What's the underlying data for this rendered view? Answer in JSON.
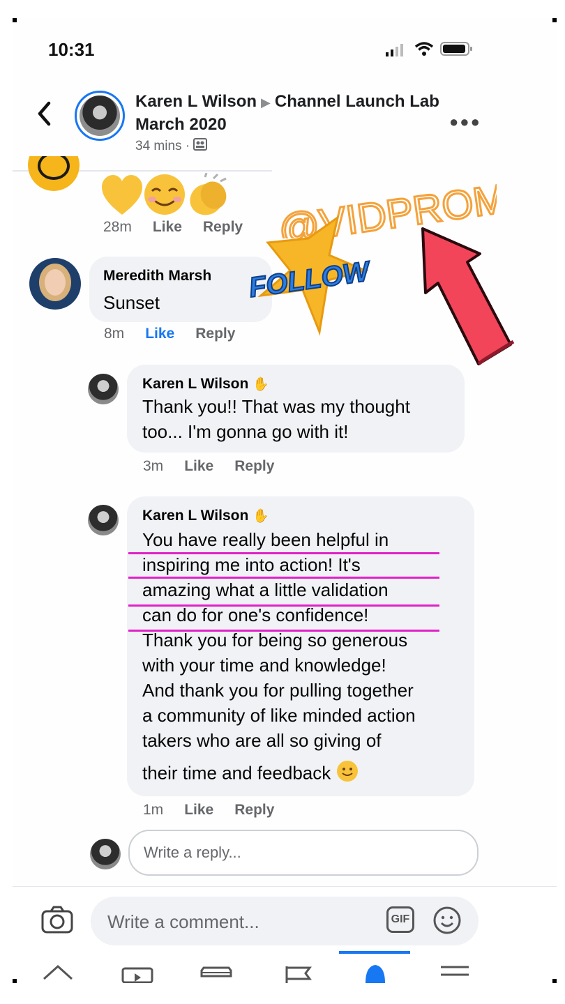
{
  "status_bar": {
    "time": "10:31"
  },
  "header": {
    "author": "Karen L Wilson",
    "group": "Channel Launch Lab March 2020",
    "time_ago": "34 mins",
    "separator": "·"
  },
  "prev_comment": {
    "time": "28m",
    "like": "Like",
    "reply": "Reply"
  },
  "comments": [
    {
      "name": "Meredith Marsh",
      "text": "Sunset",
      "time": "8m",
      "like": "Like",
      "reply": "Reply"
    },
    {
      "name": "Karen L Wilson",
      "text_lines": [
        "Thank you!! That was my thought",
        "too... I'm gonna go with it!"
      ],
      "time": "3m",
      "like": "Like",
      "reply": "Reply"
    },
    {
      "name": "Karen L Wilson",
      "text_lines": [
        "You have really been helpful in",
        "inspiring me into action! It's",
        "amazing what a little validation",
        "can do for one's confidence!",
        "Thank you for being so generous",
        "with your time and knowledge!",
        "And thank you for pulling together",
        "a community of like minded action",
        "takers who are all so giving of",
        "their time and feedback"
      ],
      "time": "1m",
      "like": "Like",
      "reply": "Reply"
    }
  ],
  "reply_box": {
    "placeholder": "Write a reply..."
  },
  "comment_box": {
    "placeholder": "Write a comment...",
    "gif_label": "GIF"
  },
  "overlay": {
    "handle": "@VIDPROMOM",
    "follow": "FOLLOW"
  },
  "icons": [
    "back-icon",
    "more-icon",
    "signal-icon",
    "wifi-icon",
    "battery-icon",
    "camera-icon",
    "gif-icon",
    "emoji-icon",
    "home-icon",
    "watch-icon",
    "marketplace-icon",
    "pages-icon",
    "notifications-icon",
    "menu-icon"
  ],
  "colors": {
    "accent": "#1877f2",
    "highlight": "#e020c8",
    "arrow": "#f2455a",
    "star": "#f7b627",
    "follow": "#2d7de0",
    "handle": "#f4a23b"
  }
}
